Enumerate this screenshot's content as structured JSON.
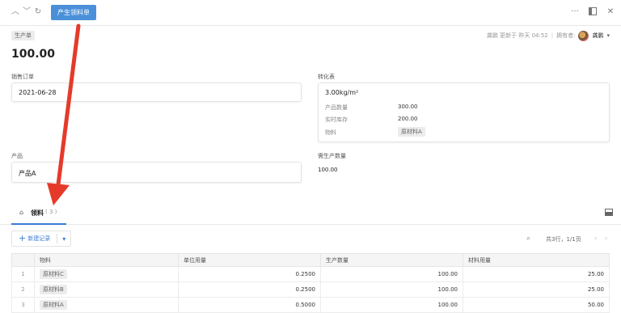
{
  "toolbar": {
    "primary_button": "产生领料单"
  },
  "record_type_tag": "生产单",
  "meta": {
    "updated": "龚鹏 更新于 昨天 04:52",
    "owner_label": "拥有者:",
    "owner_name": "龚鹏"
  },
  "title": "100.00",
  "fields": {
    "sales_order_label": "销售订单",
    "sales_order_value": "2021-06-28",
    "conversion_label": "转化表",
    "conversion_title": "3.00kg/m²",
    "conversion_rows": [
      {
        "key": "产品数量",
        "value": "300.00"
      },
      {
        "key": "实时库存",
        "value": "200.00"
      },
      {
        "key": "物料",
        "value": "原材料A"
      }
    ],
    "product_label": "产品",
    "product_value": "产品A",
    "required_qty_label": "需生产数量",
    "required_qty_value": "100.00"
  },
  "tab": {
    "label": "领料",
    "count": "( 3 )"
  },
  "list_toolbar": {
    "new_record": "新建记录",
    "summary": "共3行，1/1页"
  },
  "table": {
    "headers": [
      "物料",
      "单位用量",
      "生产数量",
      "材料用量"
    ],
    "rows": [
      {
        "index": "1",
        "material": "原材料C",
        "unit": "0.2500",
        "qty": "100.00",
        "usage": "25.00"
      },
      {
        "index": "2",
        "material": "原材料B",
        "unit": "0.2500",
        "qty": "100.00",
        "usage": "25.00"
      },
      {
        "index": "3",
        "material": "原材料A",
        "unit": "0.5000",
        "qty": "100.00",
        "usage": "50.00"
      }
    ]
  },
  "colors": {
    "primary": "#4a90d9",
    "arrow": "#e53a2a"
  }
}
